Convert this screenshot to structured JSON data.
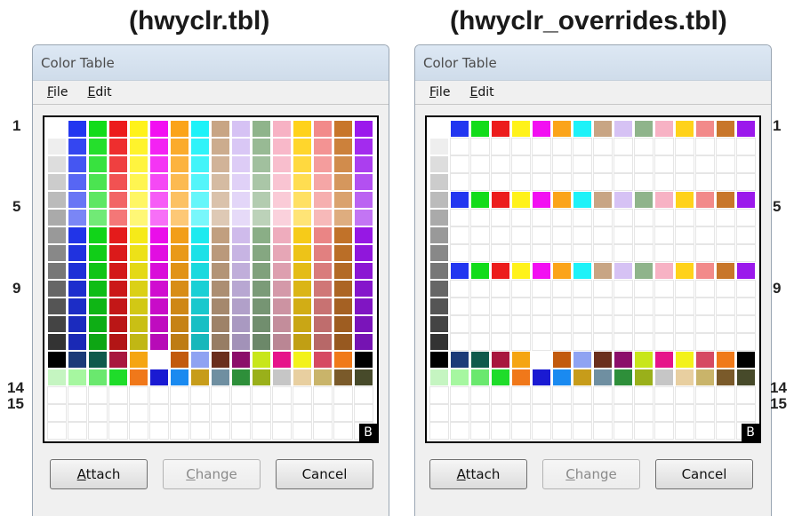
{
  "headings": [
    "(hwyclr.tbl)",
    "(hwyclr_overrides.tbl)"
  ],
  "row_labels": [
    "1",
    "5",
    "9",
    "14",
    "15"
  ],
  "windows": [
    {
      "title": "Color Table",
      "menu": [
        {
          "label": "File",
          "accel": "F",
          "rest": "ile"
        },
        {
          "label": "Edit",
          "accel": "E",
          "rest": "dit"
        }
      ],
      "buttons": {
        "attach": {
          "label": "Attach",
          "accel": "A",
          "rest": "ttach"
        },
        "change": {
          "label": "Change",
          "accel": "C",
          "rest": "hange",
          "enabled": false
        },
        "cancel": {
          "label": "Cancel"
        }
      },
      "badge": "B",
      "mode": "full"
    },
    {
      "title": "Color Table",
      "menu": [
        {
          "label": "File",
          "accel": "F",
          "rest": "ile"
        },
        {
          "label": "Edit",
          "accel": "E",
          "rest": "dit"
        }
      ],
      "buttons": {
        "attach": {
          "label": "Attach",
          "accel": "A",
          "rest": "ttach"
        },
        "change": {
          "label": "Change",
          "accel": "C",
          "rest": "hange",
          "enabled": false
        },
        "cancel": {
          "label": "Cancel"
        }
      },
      "badge": "B",
      "mode": "overrides"
    }
  ],
  "palette": {
    "base_row": [
      "#ffffff",
      "#2236f0",
      "#12dc1a",
      "#ec1c1c",
      "#fff21a",
      "#f20ff2",
      "#fba41a",
      "#1ef2f8",
      "#c8a584",
      "#d6c2f4",
      "#8fb48b",
      "#f7b2c4",
      "#ffd21a",
      "#f28a8a",
      "#c8762a",
      "#9b19ec"
    ],
    "row14": [
      "#000000",
      "#1b3a78",
      "#0f5a4c",
      "#a8173e",
      "#f5a512",
      "#ffffff",
      "#c25a0d",
      "#8fa3f2",
      "#6a2f1d",
      "#8b0e6a",
      "#c8e61a",
      "#e6148a",
      "#f3f21a",
      "#d64a62",
      "#f07a1a",
      "#000000"
    ],
    "row15": [
      "#c5f5c1",
      "#a6f7a0",
      "#6ae86e",
      "#1fdc2a",
      "#f0781a",
      "#1a1ad2",
      "#1a8af0",
      "#c79c1a",
      "#6f8fa1",
      "#2e8f3a",
      "#9ab01a",
      "#c6c6c6",
      "#e8cfa0",
      "#c9b46a",
      "#7a5a2a",
      "#474a2a"
    ]
  }
}
